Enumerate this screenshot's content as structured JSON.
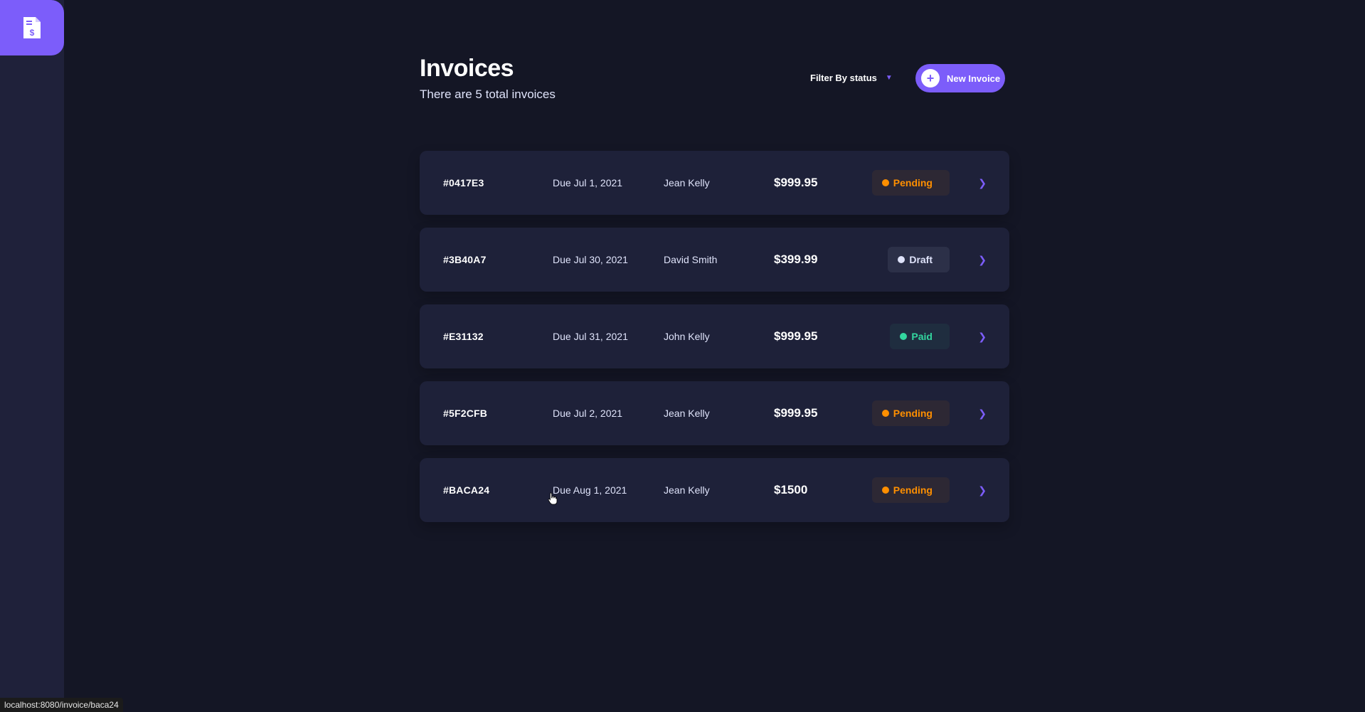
{
  "header": {
    "title": "Invoices",
    "subtitle": "There are 5 total invoices",
    "filter_label": "Filter By status",
    "new_button_label": "New Invoice"
  },
  "invoices": [
    {
      "id": "#0417E3",
      "due": "Due Jul 1, 2021",
      "name": "Jean Kelly",
      "amount": "$999.95",
      "status": "Pending"
    },
    {
      "id": "#3B40A7",
      "due": "Due Jul 30, 2021",
      "name": "David Smith",
      "amount": "$399.99",
      "status": "Draft"
    },
    {
      "id": "#E31132",
      "due": "Due Jul 31, 2021",
      "name": "John Kelly",
      "amount": "$999.95",
      "status": "Paid"
    },
    {
      "id": "#5F2CFB",
      "due": "Due Jul 2, 2021",
      "name": "Jean Kelly",
      "amount": "$999.95",
      "status": "Pending"
    },
    {
      "id": "#BACA24",
      "due": "Due Aug 1, 2021",
      "name": "Jean Kelly",
      "amount": "$1500",
      "status": "Pending"
    }
  ],
  "status_bar": {
    "url": "localhost:8080/invoice/baca24"
  },
  "colors": {
    "accent": "#7c5dfa",
    "background": "#141625",
    "card": "#1e2139",
    "pending": "#ff8f00",
    "paid": "#33d69f",
    "draft": "#dfe3fa"
  },
  "icons": {
    "logo": "invoice-dollar-icon",
    "filter": "chevron-down-icon",
    "new": "plus-icon",
    "row": "chevron-right-icon"
  }
}
